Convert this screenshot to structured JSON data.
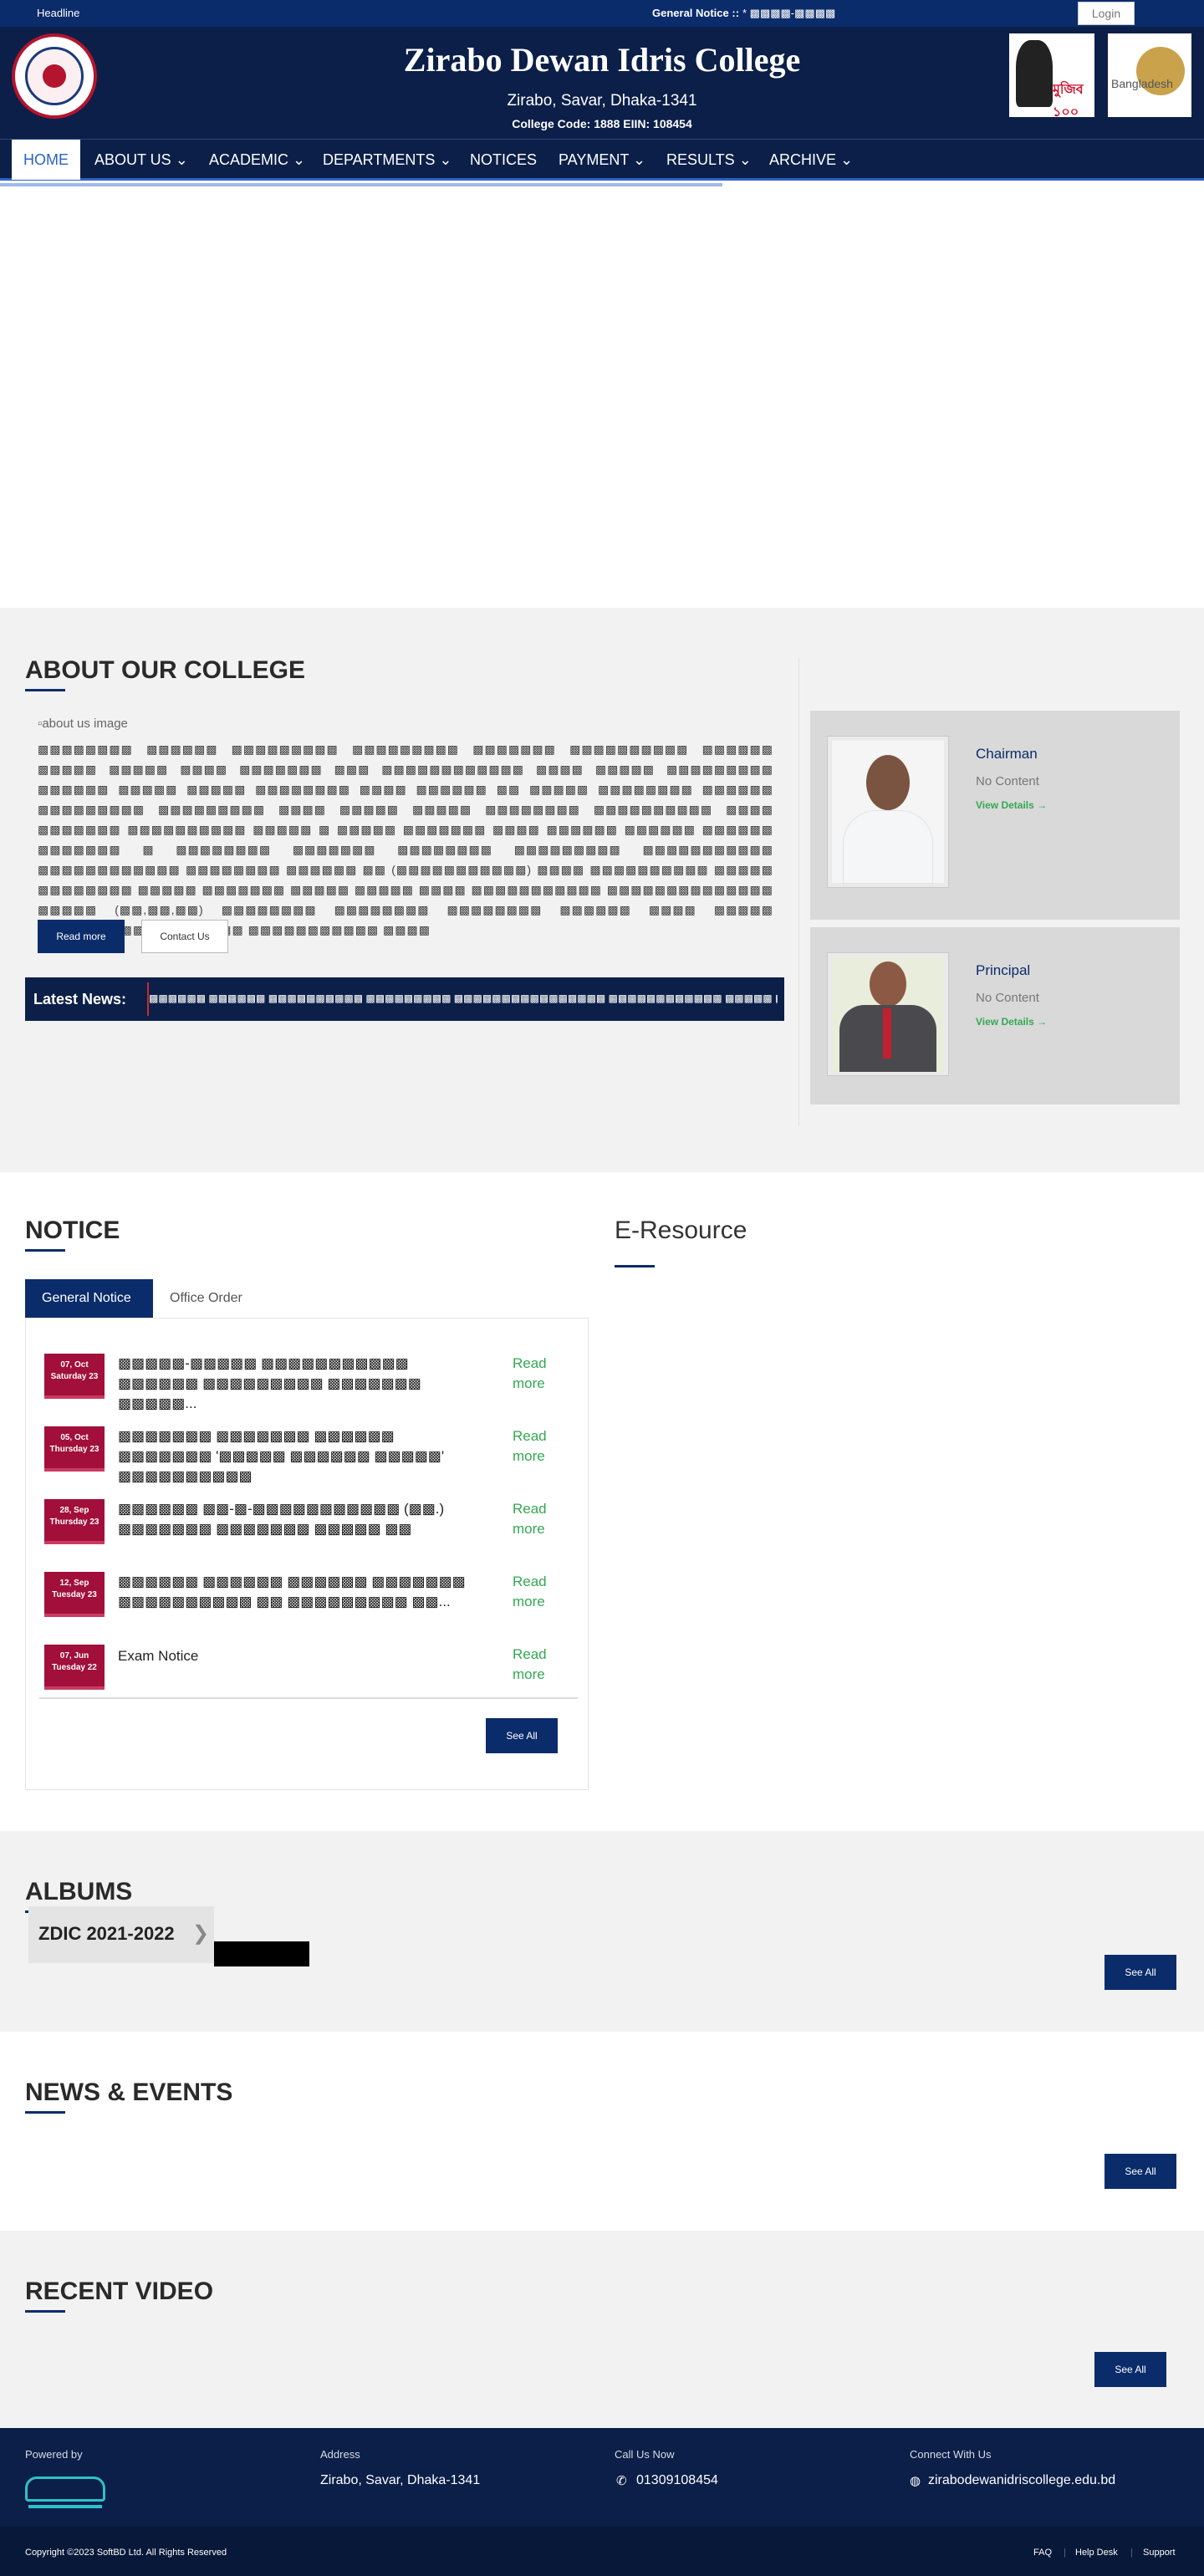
{
  "topbar": {
    "headline": "Headline",
    "general_notice_label": "General Notice ::",
    "general_notice_text": "* ▩▩▩▩-▩▩▩▩",
    "login": "Login"
  },
  "header": {
    "college_name": "Zirabo Dewan Idris College",
    "address": "Zirabo, Savar, Dhaka-1341",
    "code": "College Code: 1888 EIIN: 108454",
    "badge1_text": "মুজিব ১০০",
    "badge2_text": "Bangladesh"
  },
  "nav": {
    "items": [
      "HOME",
      "ABOUT US",
      "ACADEMIC",
      "DEPARTMENTS",
      "NOTICES",
      "PAYMENT",
      "RESULTS",
      "ARCHIVE"
    ]
  },
  "about": {
    "title": "ABOUT OUR COLLEGE",
    "image_alt": "about us image",
    "text": "▩▩▩▩▩▩▩▩ ▩▩▩▩▩▩ ▩▩▩▩▩▩▩▩▩ ▩▩▩▩▩▩▩▩▩ ▩▩▩▩▩▩▩ ▩▩▩▩▩▩▩▩▩▩ ▩▩▩▩▩▩ ▩▩▩▩▩ ▩▩▩▩▩ ▩▩▩▩ ▩▩▩▩▩▩▩ ▩▩▩ ▩▩▩▩▩▩▩▩▩▩▩▩ ▩▩▩▩ ▩▩▩▩▩ ▩▩▩▩▩▩▩▩▩ ▩▩▩▩▩▩ ▩▩▩▩▩ ▩▩▩▩▩ ▩▩▩▩▩▩▩▩ ▩▩▩▩ ▩▩▩▩▩▩ ▩▩ ▩▩▩▩▩ ▩▩▩▩▩▩▩▩ ▩▩▩▩▩▩ ▩▩▩▩▩▩▩▩▩ ▩▩▩▩▩▩▩▩▩ ▩▩▩▩ ▩▩▩▩▩ ▩▩▩▩▩ ▩▩▩▩▩▩▩▩ ▩▩▩▩▩▩▩▩▩▩ ▩▩▩▩ ▩▩▩▩▩▩▩ ▩▩▩▩▩▩▩▩▩▩ ▩▩▩▩▩ ▩ ▩▩▩▩▩ ▩▩▩▩▩▩▩ ▩▩▩▩ ▩▩▩▩▩▩ ▩▩▩▩▩▩ ▩▩▩▩▩▩ ▩▩▩▩▩▩▩ ▩ ▩▩▩▩▩▩▩▩ ▩▩▩▩▩▩▩ ▩▩▩▩▩▩▩▩ ▩▩▩▩▩▩▩▩▩ ▩▩▩▩▩▩▩▩▩▩▩ ▩▩▩▩▩▩▩▩▩▩▩▩ ▩▩▩▩▩▩▩▩ ▩▩▩▩▩▩ ▩▩ (▩▩▩▩▩▩▩▩▩▩▩) ▩▩▩▩ ▩▩▩▩▩▩▩▩▩▩ ▩▩▩▩▩ ▩▩▩▩▩▩▩▩ ▩▩▩▩▩ ▩▩▩▩▩▩▩ ▩▩▩▩▩ ▩▩▩▩▩ ▩▩▩▩ ▩▩▩▩▩▩▩▩▩▩▩ ▩▩▩▩▩▩▩▩▩▩▩▩▩▩ ▩▩▩▩▩ (▩▩,▩▩,▩▩) ▩▩▩▩▩▩▩▩ ▩▩▩▩▩▩▩▩ ▩▩▩▩▩▩▩▩ ▩▩▩▩▩▩ ▩▩▩▩ ▩▩▩▩▩ ▩▩▩▩▩▩▩▩▩▩▩▩ ▩▩▩▩▩ ▩▩▩▩▩▩▩▩▩▩▩ ▩▩▩▩",
    "read_more": "Read more",
    "contact": "Contact Us",
    "latest_label": "Latest News:",
    "latest_ticker": "▩▩▩▩▩▩ ▩▩▩▩▩▩ ▩▩▩▩▩▩▩▩▩▩ ▩▩▩▩▩▩▩▩▩ ▩▩▩▩▩▩▩▩▩▩▩▩▩▩▩▩ ▩▩▩▩▩▩▩▩▩▩▩▩ ▩▩▩▩▩ ▩▩/▩▩/▩▩▩▩ ▩▩▩▩▩ ▩▩▩▩ ▩▩.▩▩ ▩▩▩ ▩▩▩▩▩ ▩▩▩▩ ▩▩▩ ▩▩▩▩▩ ▩▩▩▩▩▩▩▩ ▩▩▩▩  || **"
  },
  "people": [
    {
      "role": "Chairman",
      "status": "No Content",
      "link": "View Details →"
    },
    {
      "role": "Principal",
      "status": "No Content",
      "link": "View Details →"
    }
  ],
  "notice": {
    "title": "NOTICE",
    "eresource_title": "E-Resource",
    "tabs": [
      "General Notice",
      "Office Order"
    ],
    "items": [
      {
        "date": "07, Oct",
        "day": "Saturday 23",
        "text": "▩▩▩▩▩-▩▩▩▩▩ ▩▩▩▩▩▩▩▩▩▩▩ ▩▩▩▩▩▩ ▩▩▩▩▩▩▩▩▩ ▩▩▩▩▩▩▩ ▩▩▩▩▩...",
        "read": "Read more"
      },
      {
        "date": "05, Oct",
        "day": "Thursday 23",
        "text": "▩▩▩▩▩▩▩ ▩▩▩▩▩▩▩ ▩▩▩▩▩▩ ▩▩▩▩▩▩▩ '▩▩▩▩▩ ▩▩▩▩▩▩ ▩▩▩▩▩' ▩▩▩▩▩▩▩▩▩▩",
        "read": "Read more"
      },
      {
        "date": "28, Sep",
        "day": "Thursday 23",
        "text": "▩▩▩▩▩▩ ▩▩-▩-▩▩▩▩▩▩▩▩▩▩▩ (▩▩.) ▩▩▩▩▩▩▩ ▩▩▩▩▩▩▩ ▩▩▩▩▩ ▩▩",
        "read": "Read more"
      },
      {
        "date": "12, Sep",
        "day": "Tuesday 23",
        "text": "▩▩▩▩▩▩ ▩▩▩▩▩▩ ▩▩▩▩▩▩ ▩▩▩▩▩▩▩ ▩▩▩▩▩▩▩▩▩▩ ▩▩ ▩▩▩▩▩▩▩▩▩ ▩▩...",
        "read": "Read more"
      },
      {
        "date": "07, Jun",
        "day": "Tuesday 22",
        "text": "Exam Notice",
        "read": "Read more"
      }
    ],
    "see_all": "See All"
  },
  "albums": {
    "title": "ALBUMS",
    "card": "ZDIC 2021-2022",
    "see_all": "See All"
  },
  "news": {
    "title": "NEWS & EVENTS",
    "see_all": "See All"
  },
  "video": {
    "title": "RECENT VIDEO",
    "see_all": "See All"
  },
  "footer": {
    "powered_label": "Powered by",
    "address_label": "Address",
    "address": "Zirabo, Savar, Dhaka-1341",
    "call_label": "Call Us Now",
    "phone": "01309108454",
    "connect_label": "Connect With Us",
    "website": "zirabodewanidriscollege.edu.bd",
    "copyright": "Copyright ©2023 SoftBD Ltd. All Rights Reserved",
    "links": [
      "FAQ",
      "Help Desk",
      "Support"
    ]
  },
  "colors": {
    "navy": "#0b1f48",
    "accent": "#0b2c6b",
    "green": "#34a853",
    "maroon": "#a10f3a"
  }
}
